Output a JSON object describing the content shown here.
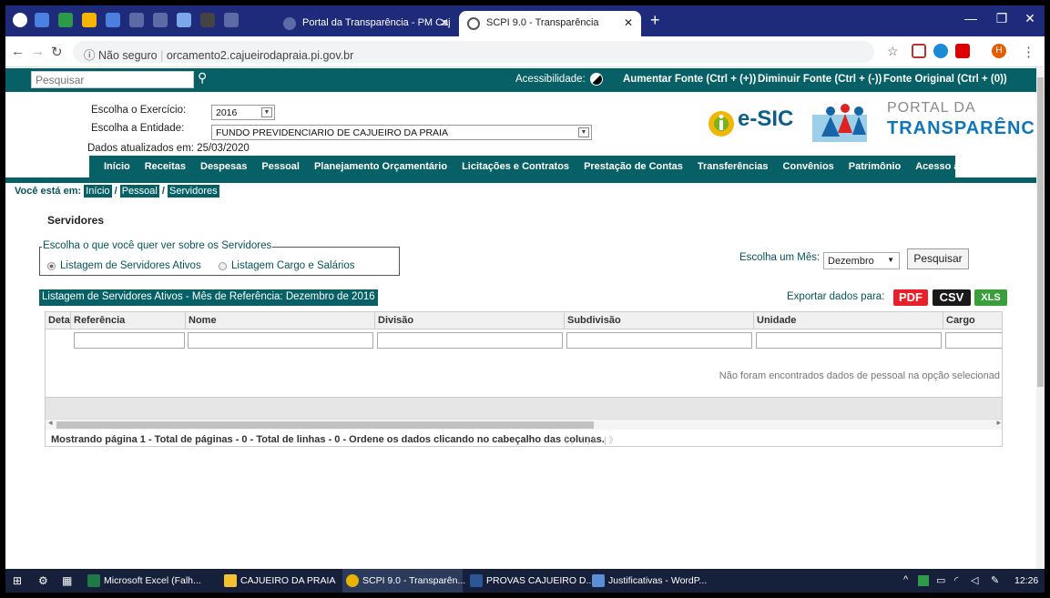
{
  "browser": {
    "tabs": [
      {
        "label": "Portal da Transparência - PM Caj",
        "close": "✕"
      },
      {
        "label": "SCPI 9.0 - Transparência",
        "close": "✕"
      }
    ],
    "new_tab": "+",
    "window_controls": [
      "—",
      "❐",
      "✕"
    ],
    "security_label": "Não seguro",
    "url": "orcamento2.cajueirodapraia.pi.gov.br",
    "profile_initial": "H"
  },
  "topbar": {
    "search_placeholder": "Pesquisar",
    "accessibility": "Acessibilidade:",
    "font_increase": "Aumentar Fonte (Ctrl + (+))",
    "font_decrease": "Diminuir Fonte (Ctrl + (-))",
    "font_original": "Fonte Original (Ctrl + (0))"
  },
  "header": {
    "exercise_label": "Escolha o Exercício:",
    "exercise_value": "2016",
    "entity_label": "Escolha a Entidade:",
    "entity_value": "FUNDO PREVIDENCIARIO DE CAJUEIRO DA PRAIA",
    "updated": "Dados atualizados em: 25/03/2020",
    "esic_logo": "e-SIC",
    "portal_logo_line1": "PORTAL DA",
    "portal_logo_line2": "TRANSPARÊNCIA"
  },
  "menu": [
    "Início",
    "Receitas",
    "Despesas",
    "Pessoal",
    "Planejamento Orçamentário",
    "Licitações e Contratos",
    "Prestação de Contas",
    "Transferências",
    "Convênios",
    "Patrimônio",
    "Acesso à Informação"
  ],
  "breadcrumb": {
    "prefix": "Você está em:",
    "items": [
      "Início",
      "Pessoal",
      "Servidores"
    ],
    "sep": "/"
  },
  "page": {
    "title": "Servidores",
    "legend": "Escolha o que você quer ver sobre os Servidores",
    "radio_active": "Listagem de Servidores Ativos",
    "radio_cargo": "Listagem Cargo e Salários",
    "month_label": "Escolha um Mês:",
    "month_value": "Dezembro",
    "search_button": "Pesquisar"
  },
  "grid": {
    "caption": "Listagem de Servidores Ativos - Mês de Referência: Dezembro de 2016",
    "export_label": "Exportar dados para:",
    "export_pdf": "PDF",
    "export_csv": "CSV",
    "export_xls": "XLS",
    "columns": [
      "Deta",
      "Referência",
      "Nome",
      "Divisão",
      "Subdivisão",
      "Unidade",
      "Cargo"
    ],
    "empty_message": "Não foram encontrados dados de pessoal na opção selecionad",
    "footer": "Mostrando página 1 - Total de páginas - 0 - Total de linhas - 0 - Ordene os dados clicando no cabeçalho das colunas.",
    "pager": "《 | 〈 | 〉 | 》"
  },
  "taskbar": {
    "items": [
      "Microsoft Excel (Falh...",
      "CAJUEIRO DA PRAIA",
      "SCPI 9.0 - Transparên...",
      "PROVAS CAJUEIRO D...",
      "Justificativas - WordP..."
    ],
    "time": "12:26"
  },
  "colors": {
    "brand": "#066065",
    "tabstrip": "#1e2a7a",
    "pdf": "#e8202a",
    "csv": "#1a1a1a",
    "xls": "#3a9e3a"
  }
}
